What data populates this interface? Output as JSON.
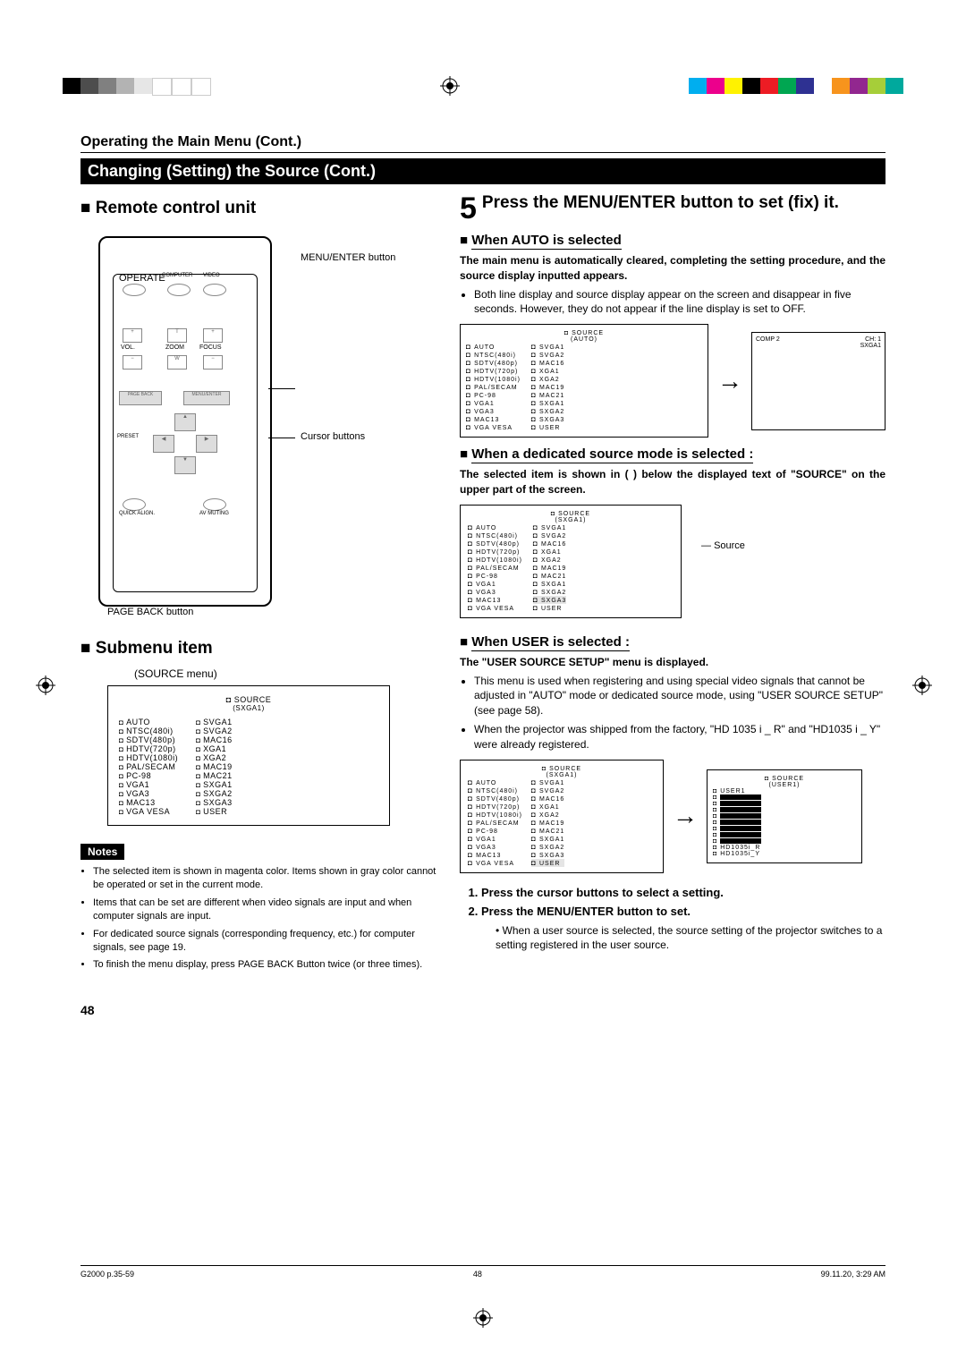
{
  "header": {
    "breadcrumb": "Operating the Main Menu (Cont.)",
    "section_bar": "Changing (Setting) the Source (Cont.)"
  },
  "left": {
    "remote_heading": "Remote control unit",
    "labels": {
      "menu_enter": "MENU/ENTER button",
      "cursor": "Cursor buttons",
      "page_back": "PAGE BACK button",
      "operate": "OPERATE",
      "computer": "COMPUTER",
      "video": "VIDEO",
      "vol": "VOL.",
      "zoom": "ZOOM",
      "focus": "FOCUS",
      "t": "T",
      "w": "W",
      "plus": "+",
      "minus": "−",
      "menu_enter_btn": "MENU/ENTER",
      "page_back_btn": "PAGE BACK",
      "preset": "PRESET",
      "quick_align": "QUICK ALIGN.",
      "av_muting": "AV MUTING"
    },
    "submenu_heading": "Submenu item",
    "submenu_caption": "(SOURCE menu)",
    "menu": {
      "title": "SOURCE",
      "sub": "(SXGA1)",
      "col1": [
        "AUTO",
        "NTSC(480i)",
        "SDTV(480p)",
        "HDTV(720p)",
        "HDTV(1080i)",
        "PAL/SECAM",
        "PC-98",
        "VGA1",
        "VGA3",
        "MAC13",
        "VGA VESA"
      ],
      "col2": [
        "SVGA1",
        "SVGA2",
        "MAC16",
        "XGA1",
        "XGA2",
        "MAC19",
        "MAC21",
        "SXGA1",
        "SXGA2",
        "SXGA3",
        "USER"
      ]
    },
    "notes_label": "Notes",
    "notes": [
      "The selected item is shown in magenta color. Items shown in gray color cannot be operated or set in the current mode.",
      "Items that can be set are different when video signals are input and when computer signals are input.",
      "For dedicated source signals (corresponding frequency, etc.) for computer signals, see page 19.",
      "To finish the menu display, press PAGE BACK Button twice (or three times)."
    ]
  },
  "right": {
    "step_num": "5",
    "step_text": "Press the MENU/ENTER button to set (fix) it.",
    "auto": {
      "heading": "When AUTO is selected",
      "bold": "The main menu is automatically cleared, completing the setting procedure, and the source display inputted appears.",
      "bullet": "Both line display and source display appear on the screen and disappear in five seconds. However, they do not appear if the line display is set to OFF.",
      "result": {
        "comp": "COMP 2",
        "ch": "CH: 1",
        "mode": "SXGA1"
      },
      "menu_sub": "(AUTO)"
    },
    "dedicated": {
      "heading": "When a dedicated source mode is selected :",
      "bold": "The selected item is shown in ( ) below the displayed text of \"SOURCE\" on the upper part of the screen.",
      "side_label": "Source",
      "menu_sub": "(SXGA1)",
      "highlight": "SXGA3"
    },
    "user": {
      "heading": "When USER is selected :",
      "bold": "The \"USER SOURCE SETUP\" menu is displayed.",
      "bullets": [
        "This menu is used when registering and using special video signals that cannot be adjusted in \"AUTO\" mode or dedicated source mode, using \"USER SOURCE SETUP\" (see page 58).",
        "When the projector was shipped from the factory, \"HD 1035 i _ R\" and \"HD1035 i _ Y\" were already registered."
      ],
      "menu_sub": "(SXGA1)",
      "user_menu_title": "SOURCE",
      "user_menu_sub": "(USER1)",
      "user_items_first": "USER1",
      "user_items_last": [
        "HD1035i_R",
        "HD1035i_Y"
      ],
      "ol": [
        "Press the cursor buttons to select a setting.",
        "Press the MENU/ENTER button to set."
      ],
      "sub_bullet": "When a user source is selected, the source setting of the projector switches to a setting registered in the user source."
    }
  },
  "page_number": "48",
  "footer": {
    "left": "G2000 p.35-59",
    "center": "48",
    "right": "99.11.20, 3:29 AM"
  },
  "colors": {
    "bw": [
      "#000000",
      "#4d4d4d",
      "#808080",
      "#b3b3b3",
      "#e6e6e6",
      "#ffffff",
      "#ffffff",
      "#ffffff"
    ],
    "cmyk": [
      "#00aeef",
      "#ec008c",
      "#fff200",
      "#000000",
      "#ed1c24",
      "#00a651",
      "#2e3192",
      "#ffffff",
      "#f7941d",
      "#92278f",
      "#a6ce39",
      "#00a99d"
    ]
  }
}
